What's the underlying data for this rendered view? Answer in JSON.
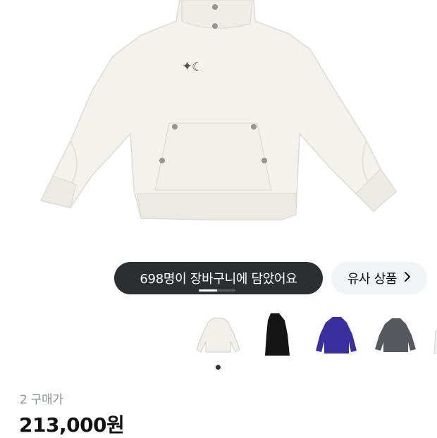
{
  "product": {
    "image_alt": "white hoodie product photo",
    "colors": {
      "hoodie": "#f3f2ec",
      "shadow": "#dcdbd3",
      "grommet": "#9a958c"
    }
  },
  "cart_banner": {
    "text": "698명이 장바구니에 담았어요",
    "progress": 0.5
  },
  "similar_button": {
    "label": "유사 상품",
    "icon": "chevron-right-icon"
  },
  "thumbnails": [
    {
      "name": "white",
      "color": "#f1f0ea",
      "selected": true
    },
    {
      "name": "black",
      "color": "#151515",
      "selected": false
    },
    {
      "name": "purple",
      "color": "#3a2f9e",
      "selected": false
    },
    {
      "name": "gray",
      "color": "#55585e",
      "selected": false
    },
    {
      "name": "light",
      "color": "#eeeeee",
      "selected": false
    }
  ],
  "purchase": {
    "count_text": "2 구매가"
  },
  "price": {
    "text": "213,000원"
  }
}
